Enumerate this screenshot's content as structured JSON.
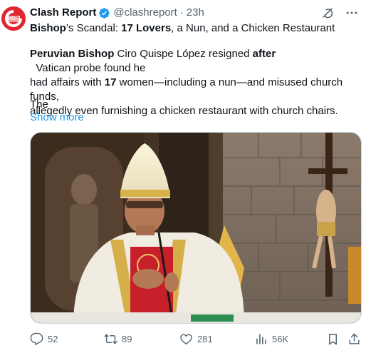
{
  "author": {
    "display_name": "Clash Report",
    "handle": "@clashreport",
    "separator": "·",
    "time": "23h",
    "avatar_text_line1": "CLASH",
    "avatar_text_line2": "REPORT",
    "verified": true
  },
  "post": {
    "title_parts": [
      "Bishop",
      "’s Scandal: ",
      "17 Lovers",
      ", a Nun, and a Chicken Restaurant"
    ],
    "body_line1_parts": [
      "Peruvian Bishop",
      " Ciro Quispe López resigned ",
      "after",
      "  Vatican probe found he"
    ],
    "body_line2_parts": [
      "had affairs with ",
      "17",
      " women—including a nun—and misused church funds,"
    ],
    "body_line3": "allegedly even furnishing a chicken restaurant with church chairs.",
    "truncated_text": "The",
    "show_more": "Show more"
  },
  "actions": {
    "replies": "52",
    "reposts": "89",
    "likes": "281",
    "views": "56K"
  },
  "icons": {
    "verified": "verified-badge-icon",
    "grok": "grok-icon",
    "more": "more-icon",
    "reply": "reply-icon",
    "repost": "repost-icon",
    "like": "heart-icon",
    "views": "views-icon",
    "bookmark": "bookmark-icon",
    "share": "share-icon"
  },
  "colors": {
    "text": "#0f1419",
    "secondary": "#536471",
    "link": "#1d9bf0",
    "verified": "#1d9bf0",
    "avatar": "#e0262f"
  }
}
